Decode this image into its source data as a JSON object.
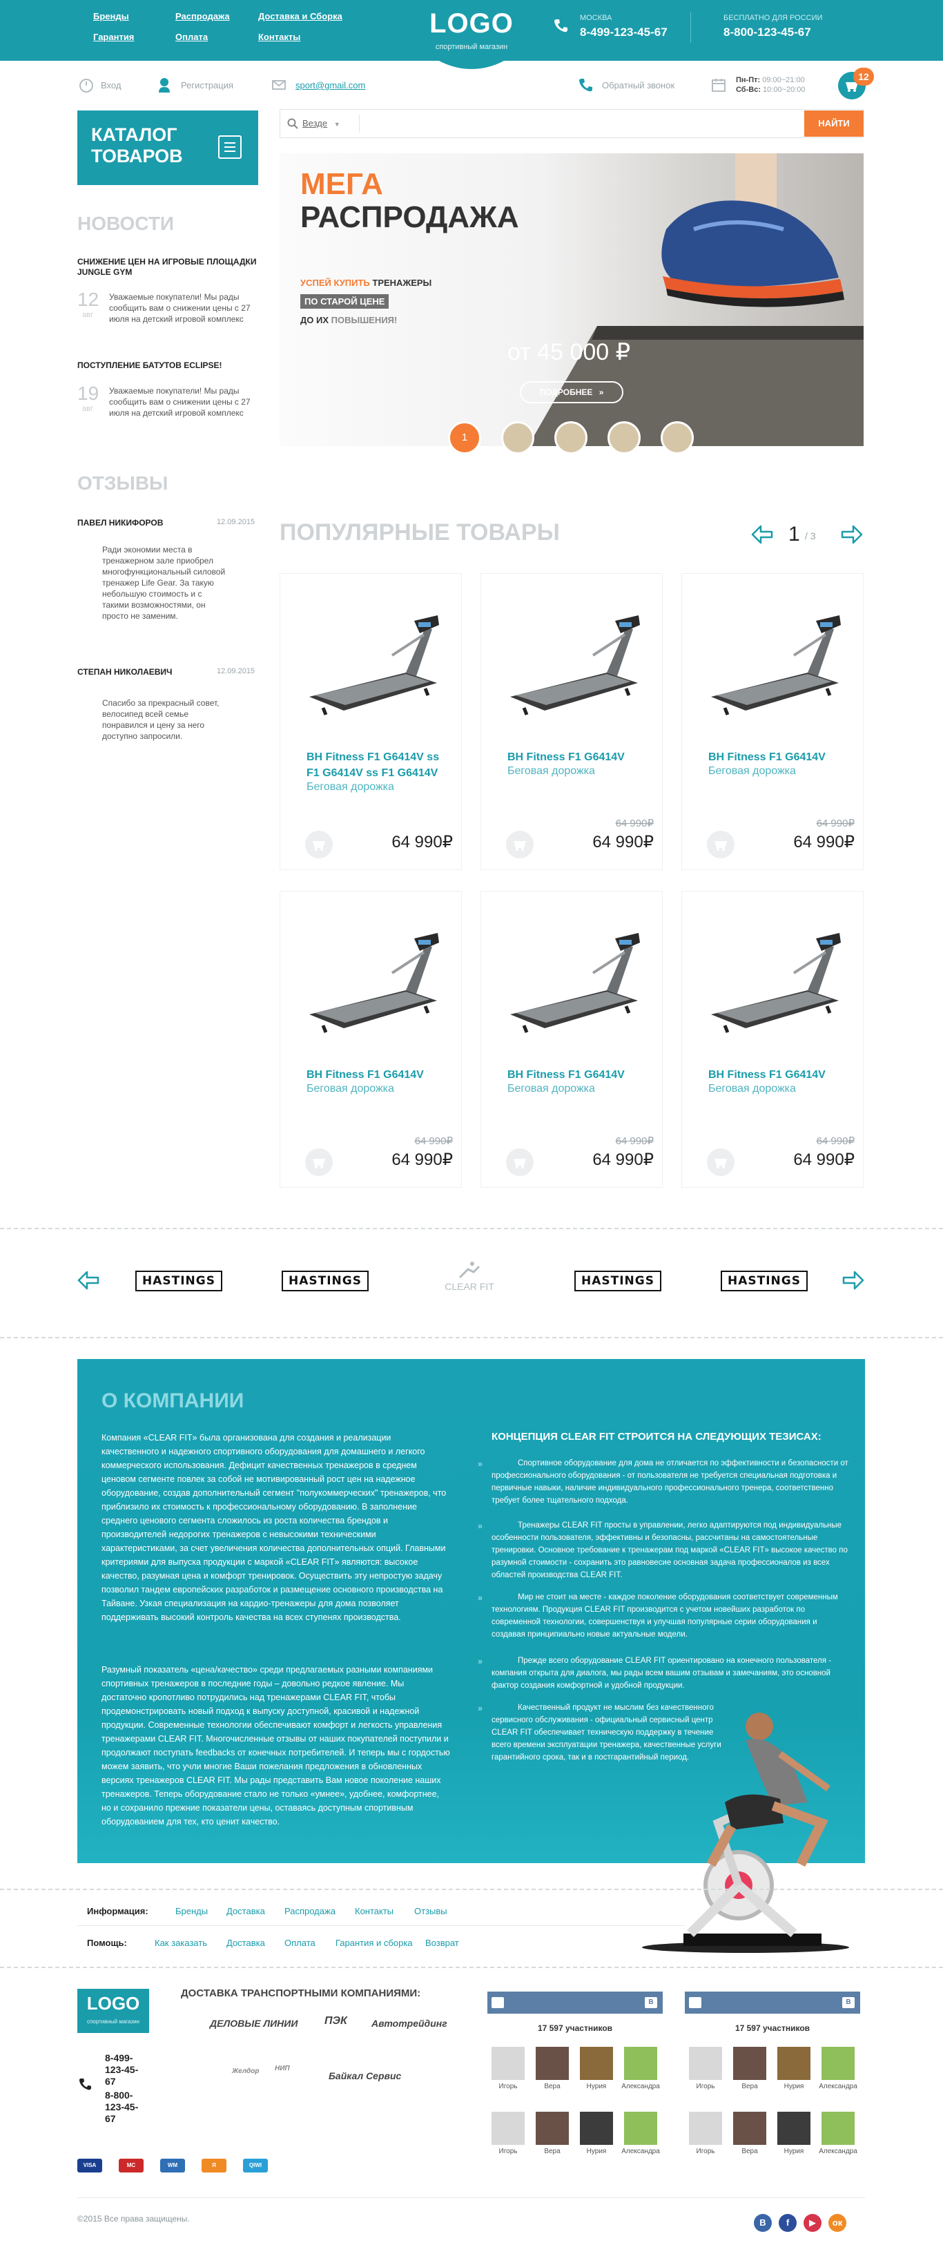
{
  "header": {
    "nav_col1": [
      "Бренды",
      "Гарантия"
    ],
    "nav_col2": [
      "Распродажа",
      "Оплата"
    ],
    "nav_col3": [
      "Доставка и Сборка",
      "Контакты"
    ],
    "logo": "LOGO",
    "logo_sub": "спортивный магазин",
    "phone1_label": "МОСКВА",
    "phone1": "8-499-123-45-67",
    "phone2_label": "БЕСПЛАТНО ДЛЯ РОССИИ",
    "phone2": "8-800-123-45-67"
  },
  "user_bar": {
    "login": "Вход",
    "register": "Регистрация",
    "email": "sport@gmail.com",
    "callback": "Обратный звонок",
    "hours_weekday_label": "Пн-Пт:",
    "hours_weekday": "09:00~21:00",
    "hours_weekend_label": "Сб-Вс:",
    "hours_weekend": "10:00~20:00",
    "cart_count": "12"
  },
  "catalog": {
    "title": "КАТАЛОГ ТОВАРОВ"
  },
  "search": {
    "scope": "Везде",
    "placeholder": "",
    "button": "НАЙТИ"
  },
  "news": {
    "heading": "НОВОСТИ",
    "items": [
      {
        "title": "СНИЖЕНИЕ ЦЕН НА ИГРОВЫЕ ПЛОЩАДКИ JUNGLE GYM",
        "day": "12",
        "month": "авг",
        "text": "Уважаемые покупатели! Мы рады сообщить вам о снижении цены с 27 июля на детский игровой комплекс"
      },
      {
        "title": "ПОСТУПЛЕНИЕ БАТУТОВ ECLIPSE!",
        "day": "19",
        "month": "авг",
        "text": "Уважаемые покупатели! Мы рады сообщить вам о снижении цены с 27 июля на детский игровой комплекс"
      }
    ]
  },
  "reviews": {
    "heading": "ОТЗЫВЫ",
    "items": [
      {
        "name": "ПАВЕЛ НИКИФОРОВ",
        "date": "12.09.2015",
        "text": "Ради экономии места в тренажерном зале приобрел многофункциональный силовой тренажер Life Gear. За такую небольшую стоимость и с такими возможностями, он просто не заменим."
      },
      {
        "name": "СТЕПАН НИКОЛАЕВИЧ",
        "date": "12.09.2015",
        "text": "Спасибо за прекрасный совет, велосипед всей семье понравился и цену за него доступно запросили."
      }
    ]
  },
  "banner": {
    "title1": "МЕГА",
    "title2": "РАСПРОДАЖА",
    "line1_accent": "УСПЕЙ КУПИТЬ",
    "line1_rest": "ТРЕНАЖЕРЫ",
    "line2": "ПО СТАРОЙ ЦЕНЕ",
    "line3_a": "ДО ИХ",
    "line3_b": "ПОВЫШЕНИЯ!",
    "price": "от 45 000 ₽",
    "more": "ПОДРОБНЕЕ",
    "active_slide": "1"
  },
  "popular": {
    "heading": "ПОПУЛЯРНЫЕ ТОВАРЫ",
    "page_current": "1",
    "page_total": "/ 3",
    "products": [
      {
        "name": "BH Fitness F1 G6414V ss F1 G6414V ss F1 G6414V",
        "type": "Беговая дорожка",
        "old_price": "",
        "price": "64 990₽"
      },
      {
        "name": "BH Fitness F1 G6414V",
        "type": "Беговая дорожка",
        "old_price": "64 990₽",
        "price": "64 990₽"
      },
      {
        "name": "BH Fitness F1 G6414V",
        "type": "Беговая дорожка",
        "old_price": "64 990₽",
        "price": "64 990₽"
      },
      {
        "name": "BH Fitness F1 G6414V",
        "type": "Беговая дорожка",
        "old_price": "64 990₽",
        "price": "64 990₽"
      },
      {
        "name": "BH Fitness F1 G6414V",
        "type": "Беговая дорожка",
        "old_price": "64 990₽",
        "price": "64 990₽"
      },
      {
        "name": "BH Fitness F1 G6414V",
        "type": "Беговая дорожка",
        "old_price": "64 990₽",
        "price": "64 990₽"
      }
    ]
  },
  "brands": [
    "HASTINGS",
    "HASTINGS",
    "CLEAR FIT",
    "HASTINGS",
    "HASTINGS"
  ],
  "about": {
    "heading": "О КОМПАНИИ",
    "p1": "Компания «CLEAR FIT» была организована для создания и реализации качественного и надежного спортивного оборудования для домашнего и легкого коммерческого использования. Дефицит качественных тренажеров в среднем ценовом сегменте повлек за собой не мотивированный рост цен на надежное оборудование, создав дополнительный сегмент \"полукоммерческих\" тренажеров, что приблизило их стоимость к профессиональному оборудованию. В заполнение среднего ценового сегмента сложилось из роста количества брендов и производителей недорогих тренажеров с невысокими техническими характеристиками, за счет увеличения количества дополнительных опций. Главными критериями для выпуска продукции с маркой «CLEAR FIT» являются: высокое качество, разумная цена и комфорт тренировок. Осуществить эту непростую задачу позволил тандем европейских разработок и размещение основного производства на Тайване. Узкая специализация на кардио-тренажеры для дома позволяет поддерживать высокий контроль качества на всех ступенях производства.",
    "p2": "Разумный показатель «цена/качество» среди предлагаемых разными компаниями спортивных тренажеров в последние годы – довольно редкое явление. Мы достаточно кропотливо потрудились над тренажерами CLEAR FIT, чтобы продемонстрировать новый подход к выпуску доступной, красивой и надежной продукции. Современные технологии обеспечивают комфорт и легкость управления тренажерами CLEAR FIT. Многочисленные отзывы от наших покупателей поступили и продолжают поступать feedbacks от конечных потребителей. И теперь мы с гордостью можем заявить, что учли многие Ваши пожелания предложения в обновленных версиях тренажеров CLEAR FIT. Мы рады представить Вам новое поколение наших тренажеров. Теперь оборудование стало не только «умнее», удобнее, комфортнее, но и сохранило прежние показатели цены, оставаясь доступным спортивным оборудованием для тех, кто ценит качество.",
    "concept_title": "КОНЦЕПЦИЯ CLEAR FIT СТРОИТСЯ НА СЛЕДУЮЩИХ ТЕЗИСАХ:",
    "points": [
      "Спортивное оборудование для дома не отличается по эффективности и безопасности от профессионального оборудования - от пользователя не требуется специальная подготовка и первичные навыки, наличие индивидуального профессионального тренера, соответственно требует более тщательного подхода.",
      "Тренажеры CLEAR FIT просты в управлении, легко адаптируются под индивидуальные особенности пользователя, эффективны и безопасны, рассчитаны на самостоятельные тренировки. Основное требование к тренажерам под маркой «CLEAR FIT» высокое качество по разумной стоимости - сохранить это равновесие основная задача профессионалов из всех областей производства CLEAR FIT.",
      "Мир не стоит на месте - каждое поколение оборудования соответствует современным технологиям. Продукция CLEAR FIT производится с учетом новейших разработок по современной технологии, совершенствуя и улучшая популярные серии оборудования и создавая принципиально новые актуальные модели.",
      "Прежде всего оборудование CLEAR FIT ориентировано на конечного пользователя - компания открыта для диалога, мы рады всем вашим отзывам и замечаниям, это основной фактор создания комфортной и удобной продукции.",
      "Качественный продукт не мыслим без качественного сервисного обслуживания - официальный сервисный центр CLEAR FIT обеспечивает техническую поддержку в течение всего времени эксплуатации тренажера, качественные услуги гарантийного срока, так и в постгарантийный период."
    ]
  },
  "info_menu": {
    "label": "Информация:",
    "links": [
      "Бренды",
      "Доставка",
      "Распродажа",
      "Контакты",
      "Отзывы"
    ]
  },
  "help_menu": {
    "label": "Помощь:",
    "links": [
      "Как заказать",
      "Доставка",
      "Оплата",
      "Гарантия и сборка",
      "Возврат"
    ]
  },
  "footer": {
    "logo": "LOGO",
    "logo_sub": "спортивный магазин",
    "phone1": "8-499-123-45-67",
    "phone2": "8-800-123-45-67",
    "shipping_title": "ДОСТАВКА ТРАНСПОРТНЫМИ КОМПАНИЯМИ:",
    "carriers": [
      "ДЕЛОВЫЕ ЛИНИИ",
      "ПЭК",
      "Автотрейдинг",
      "Желдор",
      "НИП",
      "Байкал Сервис"
    ],
    "vk": [
      {
        "count": "17 597 участников",
        "members": [
          "Игорь",
          "Вера",
          "Нурия",
          "Александра",
          "Игорь",
          "Вера",
          "Нурия",
          "Александра"
        ]
      },
      {
        "count": "17 597 участников",
        "members": [
          "Игорь",
          "Вера",
          "Нурия",
          "Александра",
          "Игорь",
          "Вера",
          "Нурия",
          "Александра"
        ]
      }
    ],
    "payments": [
      "VISA",
      "MC",
      "WM",
      "Я",
      "QIWI"
    ],
    "copyright": "©2015 Все права защищены.",
    "social": [
      "В",
      "f",
      "▶",
      "ок"
    ]
  },
  "colors": {
    "brand": "#1a9cab",
    "accent": "#f47c34",
    "vk": "#5b7fa6"
  }
}
